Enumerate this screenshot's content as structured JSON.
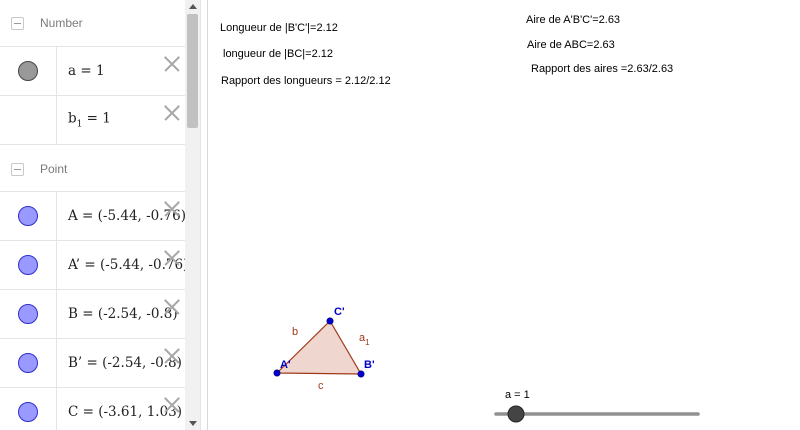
{
  "algebra": {
    "groups": {
      "number": "Number",
      "point": "Point"
    },
    "numbers": [
      {
        "name": "a",
        "value": "a = 1"
      },
      {
        "name": "b",
        "sub": "1",
        "value": " = 1"
      }
    ],
    "points": [
      {
        "expr": "A = (-5.44, -0.76)"
      },
      {
        "expr": "A’ = (-5.44, -0.76)"
      },
      {
        "expr": "B = (-2.54, -0.8)"
      },
      {
        "expr": "B’ = (-2.54, -0.8)"
      },
      {
        "expr": "C = (-3.61, 1.03)"
      }
    ]
  },
  "graphics": {
    "texts": {
      "len_bc_prime": "Longueur de |B'C'|=2.12",
      "len_bc": "longueur de |BC|=2.12",
      "ratio_len": "Rapport des longueurs = 2.12/2.12",
      "area_prime": "Aire de A'B'C'=2.63",
      "area": "Aire de ABC=2.63",
      "ratio_area": "Rapport des aires =2.63/2.63"
    },
    "triangle": {
      "label_a_prime": "A'",
      "label_b_prime": "B'",
      "label_c_prime": "C'",
      "label_b": "b",
      "label_c": "c",
      "label_a1": "a",
      "label_a1_sub": "1"
    },
    "slider": {
      "label": "a = 1",
      "value": 1
    }
  },
  "colors": {
    "point_fill": "#9999ff",
    "point_stroke": "#2f2fd0",
    "polygon_fill": "#efd6cf",
    "polygon_stroke": "#a0391a",
    "label_blue": "#0000cc",
    "label_brown": "#a0391a"
  }
}
